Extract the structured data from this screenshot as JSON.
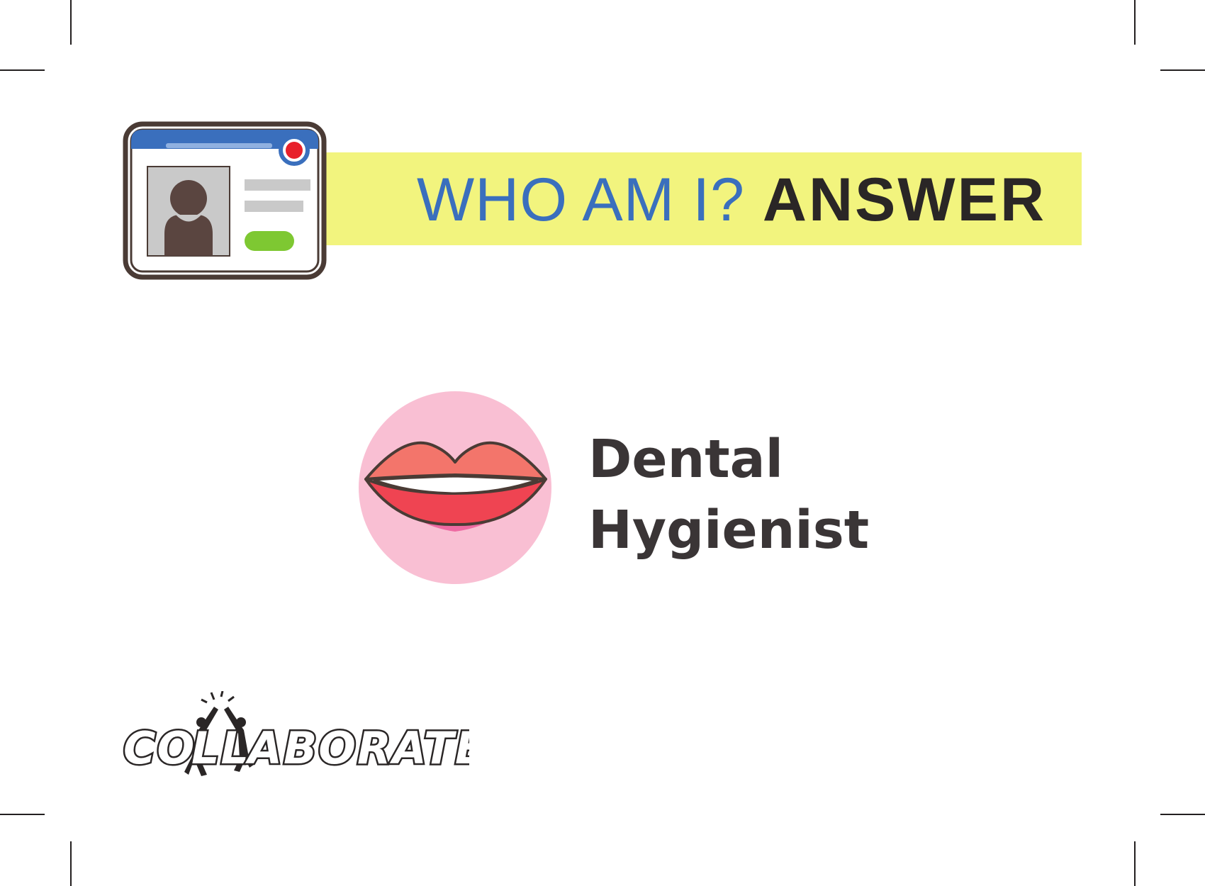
{
  "header": {
    "question": "WHO AM I?",
    "answer_label": "ANSWER"
  },
  "answer": {
    "line1": "Dental",
    "line2": "Hygienist"
  },
  "logo": {
    "text": "COLLABORATE"
  },
  "icons": {
    "id_card": "id-card-icon",
    "lips": "lips-icon"
  },
  "colors": {
    "header_bar": "#f2f47e",
    "question_text": "#3a6fbd",
    "answer_text": "#2a2626",
    "lips_circle": "#f9bfd3",
    "upper_lip": "#f3756b",
    "lower_lip": "#ef4452",
    "card_header": "#3a6fbd",
    "status_pill": "#7ec832"
  }
}
